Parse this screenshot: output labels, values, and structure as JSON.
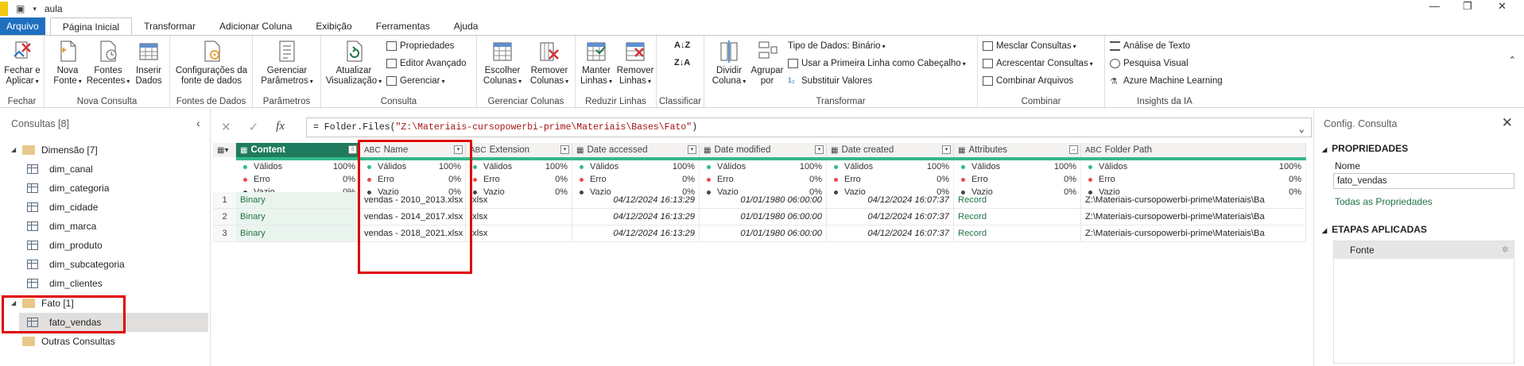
{
  "title_bar": {
    "doc_title": "aula"
  },
  "tabs": [
    "Arquivo",
    "Página Inicial",
    "Transformar",
    "Adicionar Coluna",
    "Exibição",
    "Ferramentas",
    "Ajuda"
  ],
  "ribbon": {
    "fechar": {
      "btn": "Fechar e Aplicar",
      "label": "Fechar"
    },
    "nova_consulta": {
      "nova_fonte": "Nova Fonte",
      "fontes_recentes": "Fontes Recentes",
      "inserir_dados": "Inserir Dados",
      "label": "Nova Consulta"
    },
    "fontes_de_dados": {
      "btn": "Configurações da fonte de dados",
      "label": "Fontes de Dados"
    },
    "parametros": {
      "btn": "Gerenciar Parâmetros",
      "label": "Parâmetros"
    },
    "consulta": {
      "atualizar": "Atualizar Visualização",
      "propriedades": "Propriedades",
      "editor": "Editor Avançado",
      "gerenciar": "Gerenciar",
      "label": "Consulta"
    },
    "gerenciar_colunas": {
      "escolher": "Escolher Colunas",
      "remover": "Remover Colunas",
      "label": "Gerenciar Colunas"
    },
    "reduzir_linhas": {
      "manter": "Manter Linhas",
      "remover": "Remover Linhas",
      "label": "Reduzir Linhas"
    },
    "classificar": {
      "label": "Classificar"
    },
    "transformar": {
      "dividir": "Dividir Coluna",
      "agrupar": "Agrupar por",
      "tipo": "Tipo de Dados: Binário",
      "primeira_linha": "Usar a Primeira Linha como Cabeçalho",
      "substituir": "Substituir Valores",
      "label": "Transformar"
    },
    "combinar": {
      "mesclar": "Mesclar Consultas",
      "acrescentar": "Acrescentar Consultas",
      "combinar_arquivos": "Combinar Arquivos",
      "label": "Combinar"
    },
    "insights": {
      "texto": "Análise de Texto",
      "visual": "Pesquisa Visual",
      "azure": "Azure Machine Learning",
      "label": "Insights da IA"
    }
  },
  "queries_pane": {
    "title": "Consultas [8]",
    "groups": [
      {
        "name": "Dimensão [7]",
        "items": [
          "dim_canal",
          "dim_categoria",
          "dim_cidade",
          "dim_marca",
          "dim_produto",
          "dim_subcategoria",
          "dim_clientes"
        ]
      },
      {
        "name": "Fato [1]",
        "items": [
          "fato_vendas"
        ]
      },
      {
        "name": "Outras Consultas",
        "items": []
      }
    ]
  },
  "formula": {
    "prefix": "= Folder.Files(",
    "string": "\"Z:\\Materiais-cursopowerbi-prime\\Materiais\\Bases\\Fato\"",
    "suffix": ")"
  },
  "columns": [
    "Content",
    "Name",
    "Extension",
    "Date accessed",
    "Date modified",
    "Date created",
    "Attributes",
    "Folder Path"
  ],
  "column_types": [
    "▦",
    "ABC",
    "ABC",
    "▦",
    "▦",
    "▦",
    "▦",
    "ABC"
  ],
  "quality": {
    "labels": [
      "Válidos",
      "Erro",
      "Vazio"
    ],
    "values": [
      [
        "100%",
        "0%",
        "0%"
      ],
      [
        "100%",
        "0%",
        "0%"
      ],
      [
        "100%",
        "0%",
        "0%"
      ],
      [
        "100%",
        "0%",
        "0%"
      ],
      [
        "100%",
        "0%",
        "0%"
      ],
      [
        "100%",
        "0%",
        "0%"
      ],
      [
        "100%",
        "0%",
        "0%"
      ],
      [
        "100%",
        "0%",
        "0%"
      ]
    ],
    "colors": {
      "valid": "#33b88a",
      "error": "#e84c4c",
      "empty": "#444444"
    }
  },
  "rows": [
    {
      "n": "1",
      "content": "Binary",
      "name": "vendas - 2010_2013.xlsx",
      "ext": ".xlsx",
      "accessed": "04/12/2024 16:13:29",
      "modified": "01/01/1980 06:00:00",
      "created": "04/12/2024 16:07:37",
      "attributes": "Record",
      "path": "Z:\\Materiais-cursopowerbi-prime\\Materiais\\Ba"
    },
    {
      "n": "2",
      "content": "Binary",
      "name": "vendas - 2014_2017.xlsx",
      "ext": ".xlsx",
      "accessed": "04/12/2024 16:13:29",
      "modified": "01/01/1980 06:00:00",
      "created": "04/12/2024 16:07:37",
      "attributes": "Record",
      "path": "Z:\\Materiais-cursopowerbi-prime\\Materiais\\Ba"
    },
    {
      "n": "3",
      "content": "Binary",
      "name": "vendas - 2018_2021.xlsx",
      "ext": ".xlsx",
      "accessed": "04/12/2024 16:13:29",
      "modified": "01/01/1980 06:00:00",
      "created": "04/12/2024 16:07:37",
      "attributes": "Record",
      "path": "Z:\\Materiais-cursopowerbi-prime\\Materiais\\Ba"
    }
  ],
  "settings_pane": {
    "title": "Config. Consulta",
    "properties": "PROPRIEDADES",
    "name_label": "Nome",
    "name_value": "fato_vendas",
    "all_props": "Todas as Propriedades",
    "steps_title": "ETAPAS APLICADAS",
    "steps": [
      "Fonte"
    ]
  }
}
